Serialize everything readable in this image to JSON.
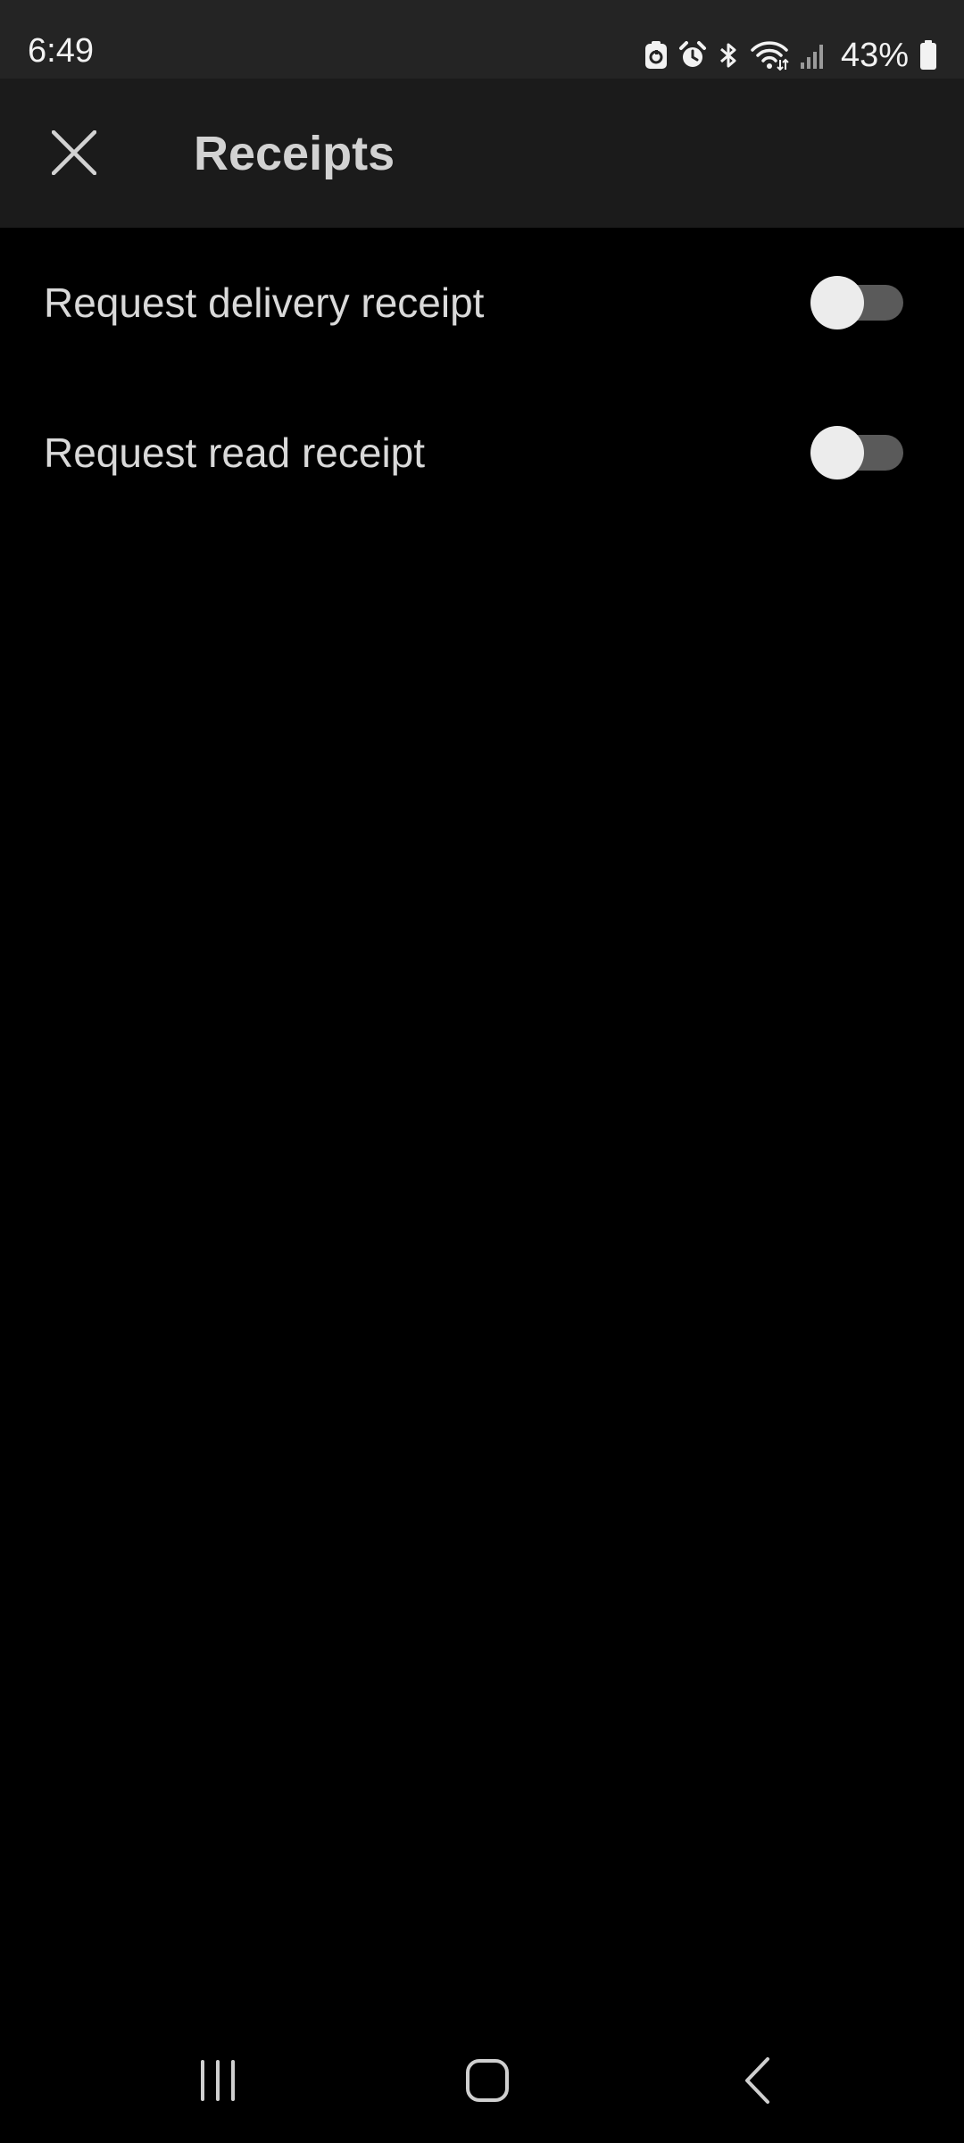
{
  "status_bar": {
    "time": "6:49",
    "battery_percent": "43%",
    "icons": [
      "screenshot-icon",
      "alarm-icon",
      "bluetooth-icon",
      "wifi-icon",
      "signal-icon",
      "battery-icon"
    ]
  },
  "header": {
    "close_icon": "close-icon",
    "title": "Receipts"
  },
  "settings": [
    {
      "label": "Request delivery receipt",
      "enabled": false
    },
    {
      "label": "Request read receipt",
      "enabled": false
    }
  ],
  "nav_bar": {
    "icons": [
      "recents-icon",
      "home-icon",
      "back-icon"
    ]
  },
  "colors": {
    "background": "#000000",
    "app_bar": "#1b1b1b",
    "status_bar": "#242424",
    "text": "#d9d9d9",
    "toggle_track_off": "#5a5a5a",
    "toggle_thumb": "#ececec"
  }
}
